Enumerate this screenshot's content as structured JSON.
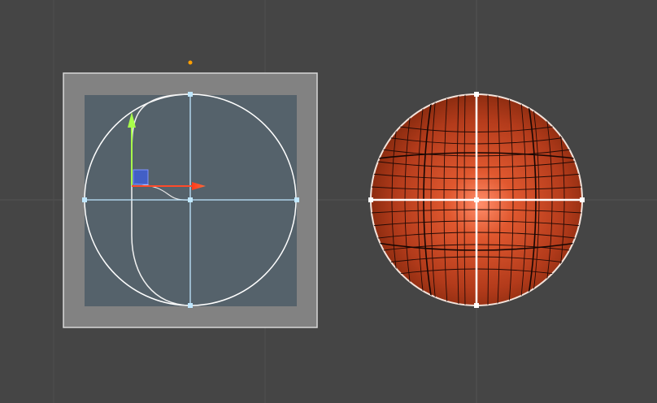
{
  "scene": {
    "background_color": "#454545",
    "grid_color": "#525252",
    "left_object": {
      "type": "sprite-frame-with-circle",
      "frame_color": "#828282",
      "frame_border": "#cfcfcf",
      "inner_color": "#55626b",
      "outline_color": "#ffffff",
      "guide_color": "#bfe7ff"
    },
    "gizmo": {
      "x_axis_color": "#ff4a2a",
      "y_axis_color": "#a8ff4a",
      "plane_handle_color": "#3f5fd6",
      "pivot_dot_color": "#ff9f00"
    },
    "right_object": {
      "type": "sphere-rect-tool",
      "base_color": "#b33b1b",
      "highlight_color": "#ff8d6a",
      "mesh_line_color": "#1f0a05",
      "handle_color": "#ffffff"
    }
  },
  "icons": {
    "move_tool": "move-gizmo-icon",
    "rect_tool": "rect-tool-icon"
  }
}
